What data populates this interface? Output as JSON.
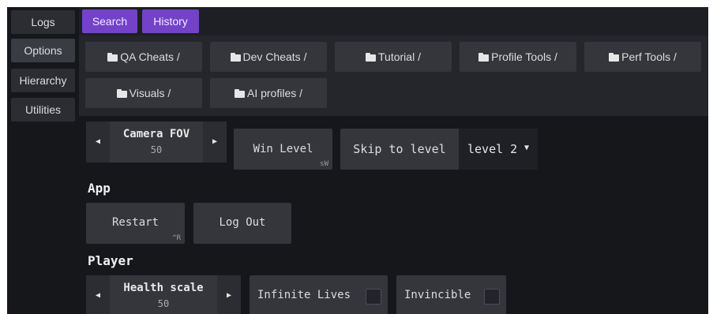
{
  "sidebar": {
    "items": [
      {
        "label": "Logs",
        "active": false
      },
      {
        "label": "Options",
        "active": true
      },
      {
        "label": "Hierarchy",
        "active": false
      },
      {
        "label": "Utilities",
        "active": false
      }
    ]
  },
  "topbar": {
    "search_label": "Search",
    "history_label": "History",
    "accent_color": "#7342c8"
  },
  "folders": {
    "items": [
      {
        "label": "QA Cheats /"
      },
      {
        "label": "Dev Cheats /"
      },
      {
        "label": "Tutorial /"
      },
      {
        "label": "Profile Tools /"
      },
      {
        "label": "Perf Tools /"
      },
      {
        "label": "Visuals /"
      },
      {
        "label": "AI profiles /"
      }
    ]
  },
  "top_controls": {
    "camera_fov": {
      "label": "Camera FOV",
      "value": "50"
    },
    "win_level": {
      "label": "Win Level",
      "shortcut": "sW"
    },
    "skip_to_level": {
      "label": "Skip to level",
      "selected": "level 2"
    }
  },
  "app_section": {
    "title": "App",
    "restart": {
      "label": "Restart",
      "shortcut": "^R"
    },
    "logout": {
      "label": "Log Out"
    }
  },
  "player_section": {
    "title": "Player",
    "health_scale": {
      "label": "Health scale",
      "value": "50"
    },
    "infinite_lives": {
      "label": "Infinite Lives",
      "checked": false
    },
    "invincible": {
      "label": "Invincible",
      "checked": false
    }
  }
}
